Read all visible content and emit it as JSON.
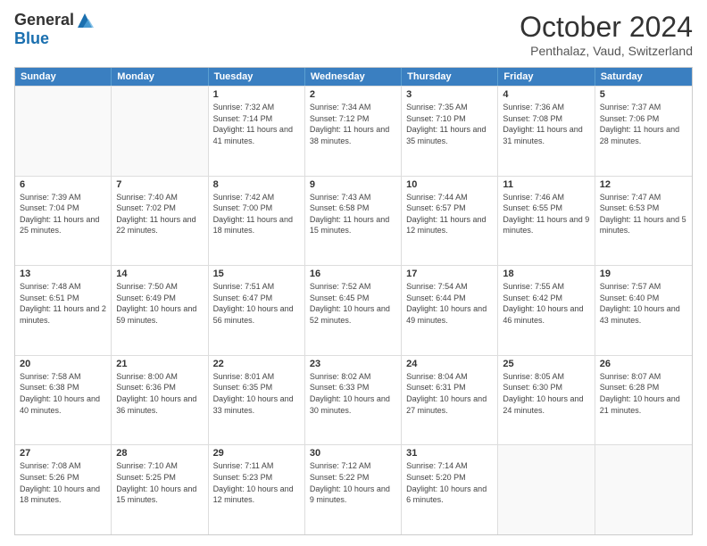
{
  "header": {
    "logo_general": "General",
    "logo_blue": "Blue",
    "month_title": "October 2024",
    "location": "Penthalaz, Vaud, Switzerland"
  },
  "days_of_week": [
    "Sunday",
    "Monday",
    "Tuesday",
    "Wednesday",
    "Thursday",
    "Friday",
    "Saturday"
  ],
  "weeks": [
    [
      {
        "day": "",
        "info": ""
      },
      {
        "day": "",
        "info": ""
      },
      {
        "day": "1",
        "info": "Sunrise: 7:32 AM\nSunset: 7:14 PM\nDaylight: 11 hours and 41 minutes."
      },
      {
        "day": "2",
        "info": "Sunrise: 7:34 AM\nSunset: 7:12 PM\nDaylight: 11 hours and 38 minutes."
      },
      {
        "day": "3",
        "info": "Sunrise: 7:35 AM\nSunset: 7:10 PM\nDaylight: 11 hours and 35 minutes."
      },
      {
        "day": "4",
        "info": "Sunrise: 7:36 AM\nSunset: 7:08 PM\nDaylight: 11 hours and 31 minutes."
      },
      {
        "day": "5",
        "info": "Sunrise: 7:37 AM\nSunset: 7:06 PM\nDaylight: 11 hours and 28 minutes."
      }
    ],
    [
      {
        "day": "6",
        "info": "Sunrise: 7:39 AM\nSunset: 7:04 PM\nDaylight: 11 hours and 25 minutes."
      },
      {
        "day": "7",
        "info": "Sunrise: 7:40 AM\nSunset: 7:02 PM\nDaylight: 11 hours and 22 minutes."
      },
      {
        "day": "8",
        "info": "Sunrise: 7:42 AM\nSunset: 7:00 PM\nDaylight: 11 hours and 18 minutes."
      },
      {
        "day": "9",
        "info": "Sunrise: 7:43 AM\nSunset: 6:58 PM\nDaylight: 11 hours and 15 minutes."
      },
      {
        "day": "10",
        "info": "Sunrise: 7:44 AM\nSunset: 6:57 PM\nDaylight: 11 hours and 12 minutes."
      },
      {
        "day": "11",
        "info": "Sunrise: 7:46 AM\nSunset: 6:55 PM\nDaylight: 11 hours and 9 minutes."
      },
      {
        "day": "12",
        "info": "Sunrise: 7:47 AM\nSunset: 6:53 PM\nDaylight: 11 hours and 5 minutes."
      }
    ],
    [
      {
        "day": "13",
        "info": "Sunrise: 7:48 AM\nSunset: 6:51 PM\nDaylight: 11 hours and 2 minutes."
      },
      {
        "day": "14",
        "info": "Sunrise: 7:50 AM\nSunset: 6:49 PM\nDaylight: 10 hours and 59 minutes."
      },
      {
        "day": "15",
        "info": "Sunrise: 7:51 AM\nSunset: 6:47 PM\nDaylight: 10 hours and 56 minutes."
      },
      {
        "day": "16",
        "info": "Sunrise: 7:52 AM\nSunset: 6:45 PM\nDaylight: 10 hours and 52 minutes."
      },
      {
        "day": "17",
        "info": "Sunrise: 7:54 AM\nSunset: 6:44 PM\nDaylight: 10 hours and 49 minutes."
      },
      {
        "day": "18",
        "info": "Sunrise: 7:55 AM\nSunset: 6:42 PM\nDaylight: 10 hours and 46 minutes."
      },
      {
        "day": "19",
        "info": "Sunrise: 7:57 AM\nSunset: 6:40 PM\nDaylight: 10 hours and 43 minutes."
      }
    ],
    [
      {
        "day": "20",
        "info": "Sunrise: 7:58 AM\nSunset: 6:38 PM\nDaylight: 10 hours and 40 minutes."
      },
      {
        "day": "21",
        "info": "Sunrise: 8:00 AM\nSunset: 6:36 PM\nDaylight: 10 hours and 36 minutes."
      },
      {
        "day": "22",
        "info": "Sunrise: 8:01 AM\nSunset: 6:35 PM\nDaylight: 10 hours and 33 minutes."
      },
      {
        "day": "23",
        "info": "Sunrise: 8:02 AM\nSunset: 6:33 PM\nDaylight: 10 hours and 30 minutes."
      },
      {
        "day": "24",
        "info": "Sunrise: 8:04 AM\nSunset: 6:31 PM\nDaylight: 10 hours and 27 minutes."
      },
      {
        "day": "25",
        "info": "Sunrise: 8:05 AM\nSunset: 6:30 PM\nDaylight: 10 hours and 24 minutes."
      },
      {
        "day": "26",
        "info": "Sunrise: 8:07 AM\nSunset: 6:28 PM\nDaylight: 10 hours and 21 minutes."
      }
    ],
    [
      {
        "day": "27",
        "info": "Sunrise: 7:08 AM\nSunset: 5:26 PM\nDaylight: 10 hours and 18 minutes."
      },
      {
        "day": "28",
        "info": "Sunrise: 7:10 AM\nSunset: 5:25 PM\nDaylight: 10 hours and 15 minutes."
      },
      {
        "day": "29",
        "info": "Sunrise: 7:11 AM\nSunset: 5:23 PM\nDaylight: 10 hours and 12 minutes."
      },
      {
        "day": "30",
        "info": "Sunrise: 7:12 AM\nSunset: 5:22 PM\nDaylight: 10 hours and 9 minutes."
      },
      {
        "day": "31",
        "info": "Sunrise: 7:14 AM\nSunset: 5:20 PM\nDaylight: 10 hours and 6 minutes."
      },
      {
        "day": "",
        "info": ""
      },
      {
        "day": "",
        "info": ""
      }
    ]
  ]
}
